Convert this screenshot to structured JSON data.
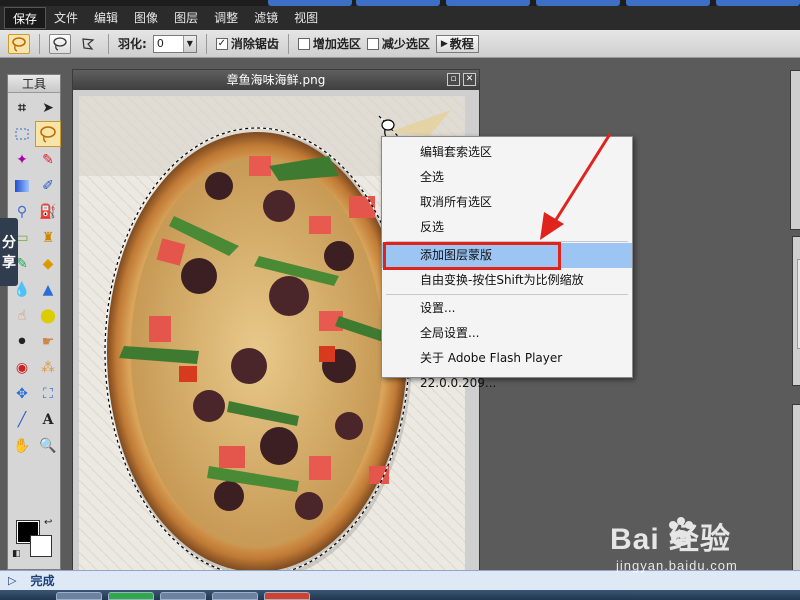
{
  "menu": {
    "items": [
      "保存",
      "文件",
      "编辑",
      "图像",
      "图层",
      "调整",
      "滤镜",
      "视图"
    ]
  },
  "options": {
    "feather_label": "羽化:",
    "feather_value": "0",
    "antialias_label": "消除锯齿",
    "antialias_checked": "✓",
    "add_selection_label": "增加选区",
    "subtract_selection_label": "减少选区",
    "tutorial_label": "教程"
  },
  "toolbox": {
    "title": "工具"
  },
  "share": {
    "line1": "分",
    "line2": "享"
  },
  "document": {
    "title": "章鱼海味海鲜.png",
    "minimize_glyph": "▫",
    "close_glyph": "✕"
  },
  "context_menu": {
    "items": [
      "编辑套索选区",
      "全选",
      "取消所有选区",
      "反选",
      "添加图层蒙版",
      "自由变换-按住Shift为比例缩放",
      "设置...",
      "全局设置...",
      "关于 Adobe Flash Player 22.0.0.209..."
    ],
    "highlighted_index": 4
  },
  "status": {
    "text": "完成"
  },
  "watermark": {
    "brand": "Bai  经验",
    "url": "jingyan.baidu.com"
  },
  "colors": {
    "menubar": "#2b2b2b",
    "highlight": "#9cc5f4",
    "annotation_red": "#e0231d"
  }
}
